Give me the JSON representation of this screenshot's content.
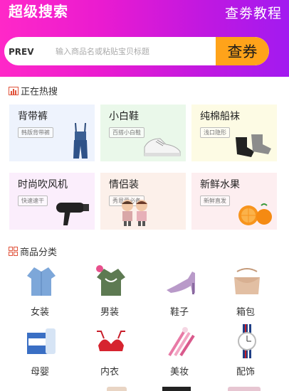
{
  "header": {
    "brand": "超级搜索",
    "tutorial_link": "查劵教程",
    "prev_label": "PREV",
    "search_placeholder": "输入商品名或粘贴宝贝标题",
    "search_button": "查券"
  },
  "hot_search": {
    "title": "正在热搜",
    "cards": [
      {
        "title": "背带裤",
        "tag": "韩版背带裤",
        "bg": "#eef3fd"
      },
      {
        "title": "小白鞋",
        "tag": "百搭小白鞋",
        "bg": "#eaf8ea"
      },
      {
        "title": "纯棉船袜",
        "tag": "浅口隐形",
        "bg": "#fdfbe4"
      },
      {
        "title": "时尚吹风机",
        "tag": "快速速干",
        "bg": "#fbeefc"
      },
      {
        "title": "情侣装",
        "tag": "秀恩爱必备",
        "bg": "#fcf0ea"
      },
      {
        "title": "新鲜水果",
        "tag": "新鲜直发",
        "bg": "#fdeef0"
      }
    ]
  },
  "categories": {
    "title": "商品分类",
    "items": [
      {
        "label": "女装"
      },
      {
        "label": "男装"
      },
      {
        "label": "鞋子"
      },
      {
        "label": "箱包"
      },
      {
        "label": "母婴"
      },
      {
        "label": "内衣"
      },
      {
        "label": "美妆"
      },
      {
        "label": "配饰"
      }
    ]
  }
}
